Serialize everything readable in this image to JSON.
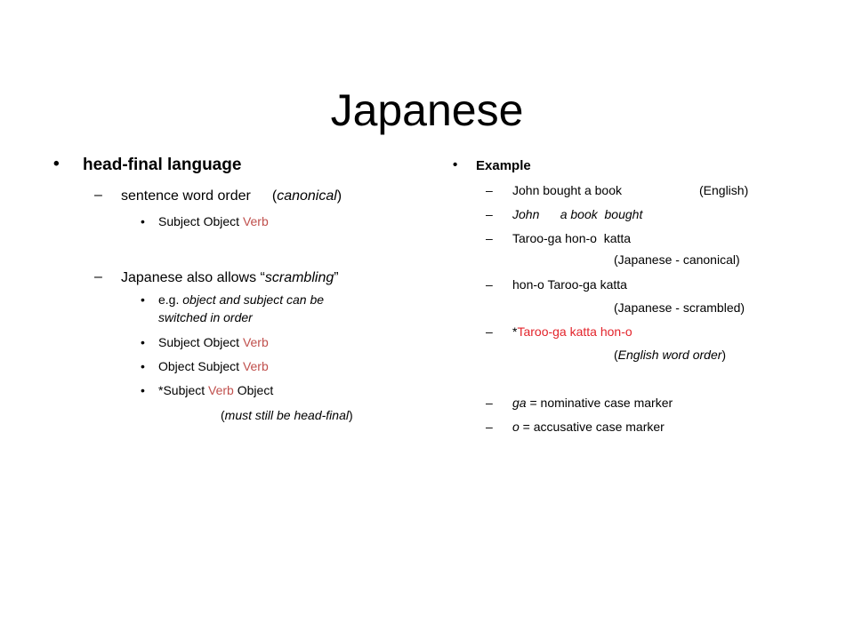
{
  "slide": {
    "title": "Japanese",
    "left": {
      "heading": "head-final language",
      "canonical": {
        "label": "sentence word order",
        "note": "canonical",
        "items": [
          {
            "subject_object": "Subject Object ",
            "verb": "Verb"
          }
        ]
      },
      "scrambling": {
        "label_prefix": "Japanese also allows “",
        "label_italic": "scrambling",
        "label_suffix": "”",
        "eg_prefix": "e.g. ",
        "eg_line1": "object and subject can be",
        "eg_line2": "switched in order",
        "items": [
          {
            "a": "Subject Object ",
            "verb": "Verb",
            "b": ""
          },
          {
            "a": "Object Subject ",
            "verb": "Verb",
            "b": ""
          },
          {
            "a": "*Subject ",
            "verb": "Verb",
            "b": " Object"
          }
        ],
        "note": "must still be head-final"
      }
    },
    "right": {
      "heading": "Example",
      "items": [
        {
          "text": "John bought a book",
          "gloss": "(English)"
        },
        {
          "text_italic": "John      a book  bought"
        },
        {
          "text": "Taroo-ga hon-o  katta",
          "gloss": "(Japanese - canonical)"
        },
        {
          "text": "hon-o Taroo-ga katta",
          "gloss": "(Japanese - scrambled)"
        },
        {
          "star": "*",
          "text_red": "Taroo-ga katta hon-o",
          "gloss_italic": "English word order"
        },
        {
          "term": "ga",
          "definition": " = nominative case marker"
        },
        {
          "term": "o",
          "definition": " = accusative case marker"
        }
      ]
    },
    "colors": {
      "verb_red": "#c0504d",
      "ungrammatical_red": "#e3242b",
      "text": "#000000"
    }
  }
}
